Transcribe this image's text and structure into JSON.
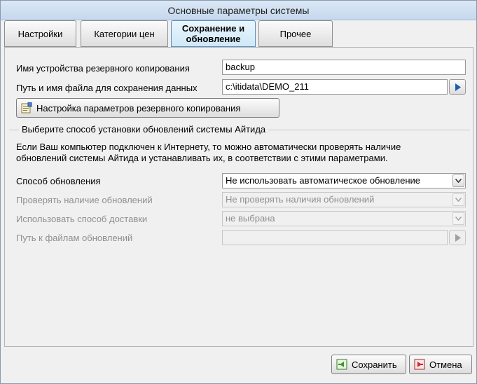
{
  "window": {
    "title": "Основные параметры системы"
  },
  "tabs": [
    {
      "label": "Настройки"
    },
    {
      "label": "Категории цен"
    },
    {
      "label_line1": "Сохранение и",
      "label_line2": "обновление"
    },
    {
      "label": "Прочее"
    }
  ],
  "backup": {
    "device_label": "Имя устройства резервного копирования",
    "device_value": "backup",
    "path_label": "Путь и имя файла для сохранения данных",
    "path_value": "c:\\itidata\\DEMO_211",
    "settings_button": "Настройка параметров резервного копирования"
  },
  "updates": {
    "group_title": "Выберите способ установки обновлений системы Айтида",
    "description_line1": "Если Ваш компьютер подключен к Интернету, то можно автоматически проверять наличие",
    "description_line2": "обновлений системы Айтида и устанавливать их, в соответствии с этими параметрами.",
    "method_label": "Способ обновления",
    "method_value": "Не использовать автоматическое обновление",
    "check_label": "Проверять наличие обновлений",
    "check_value": "Не проверять наличия обновлений",
    "delivery_label": "Использовать способ доставки",
    "delivery_value": "не выбрана",
    "files_path_label": "Путь к файлам обновлений",
    "files_path_value": ""
  },
  "footer": {
    "save": "Сохранить",
    "cancel": "Отмена"
  },
  "icons": {
    "browse": "play-arrow-icon",
    "combo": "chevron-down-icon",
    "backup_settings": "backup-settings-icon",
    "save": "save-icon",
    "cancel": "cancel-icon"
  }
}
